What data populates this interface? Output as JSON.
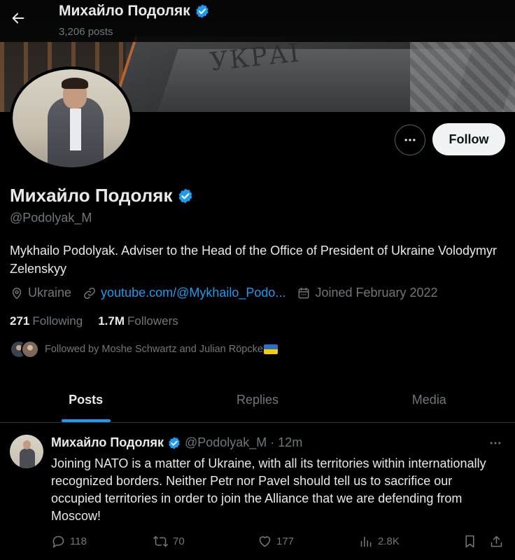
{
  "header": {
    "name": "Михайло Подоляк",
    "posts_count": "3,206 posts"
  },
  "banner": {
    "engraving": "УКРАЇ"
  },
  "profile": {
    "name": "Михайло Подоляк",
    "handle": "@Podolyak_M",
    "bio": "Mykhailo Podolyak. Adviser to the Head of the Office of President of Ukraine Volodymyr Zelenskyy",
    "location": "Ukraine",
    "website": "youtube.com/@Mykhailo_Podo...",
    "joined": "Joined February 2022",
    "following_count": "271",
    "following_label": "Following",
    "followers_count": "1.7M",
    "followers_label": "Followers",
    "followed_by": "Followed by Moshe Schwartz and Julian Röpcke",
    "follow_label": "Follow",
    "verified_color": "#1d9bf0"
  },
  "tabs": [
    {
      "label": "Posts",
      "active": true
    },
    {
      "label": "Replies",
      "active": false
    },
    {
      "label": "Media",
      "active": false
    }
  ],
  "post": {
    "name": "Михайло Подоляк",
    "handle": "@Podolyak_M",
    "dot": "·",
    "time": "12m",
    "text": "Joining NATO is a matter of Ukraine, with all its territories within internationally recognized borders. Neither Petr nor Pavel should tell us to sacrifice our occupied territories in order to join the Alliance that we are defending from Moscow!",
    "replies": "118",
    "reposts": "70",
    "likes": "177",
    "views": "2.8K"
  },
  "icons": {
    "back": "arrow-left-icon",
    "verified": "verified-badge-icon",
    "more": "more-dots-icon",
    "location": "location-pin-icon",
    "link": "link-icon",
    "calendar": "calendar-icon",
    "reply": "reply-icon",
    "repost": "repost-icon",
    "like": "heart-icon",
    "views": "views-icon",
    "bookmark": "bookmark-icon",
    "share": "share-icon"
  }
}
